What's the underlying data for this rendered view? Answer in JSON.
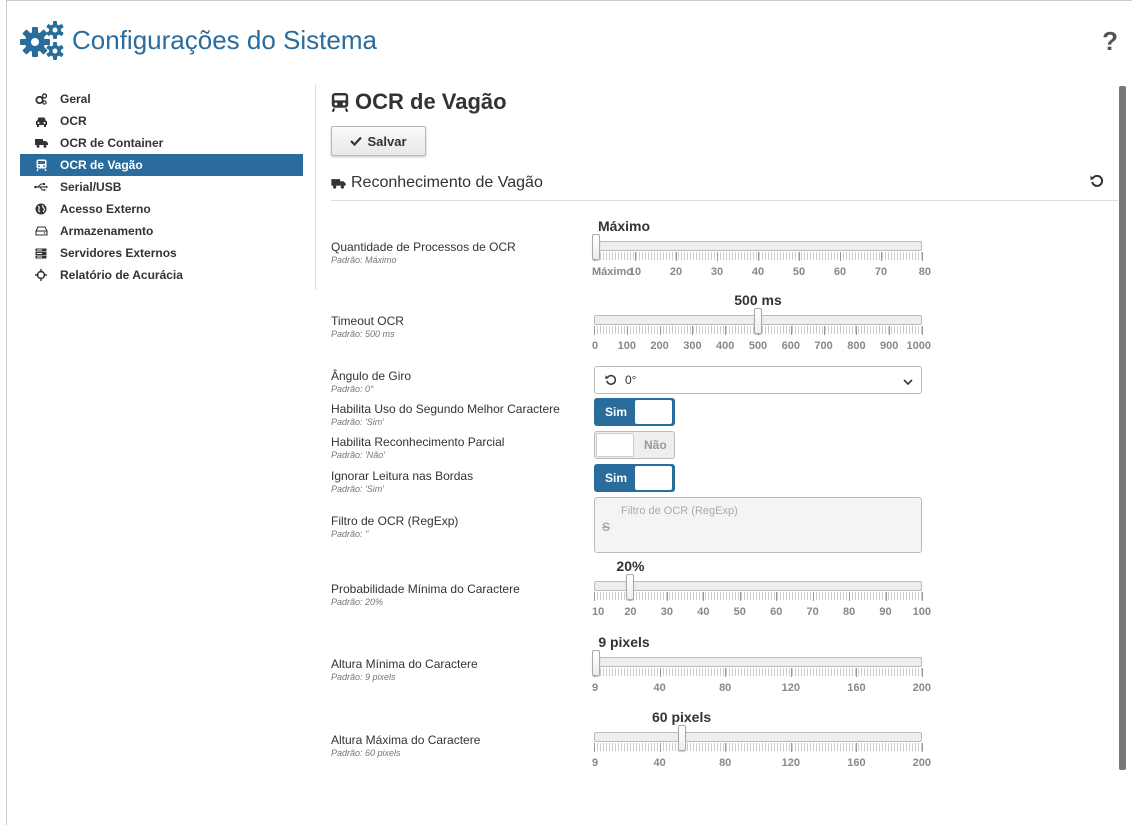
{
  "header": {
    "title": "Configurações do Sistema",
    "help": "?"
  },
  "sidebar": {
    "items": [
      {
        "label": "Geral",
        "icon": "gears-icon",
        "active": false
      },
      {
        "label": "OCR",
        "icon": "car-icon",
        "active": false
      },
      {
        "label": "OCR de Container",
        "icon": "truck-icon",
        "active": false
      },
      {
        "label": "OCR de Vagão",
        "icon": "train-icon",
        "active": true
      },
      {
        "label": "Serial/USB",
        "icon": "usb-icon",
        "active": false
      },
      {
        "label": "Acesso Externo",
        "icon": "globe-icon",
        "active": false
      },
      {
        "label": "Armazenamento",
        "icon": "hdd-icon",
        "active": false
      },
      {
        "label": "Servidores Externos",
        "icon": "server-icon",
        "active": false
      },
      {
        "label": "Relatório de Acurácia",
        "icon": "crosshair-icon",
        "active": false
      }
    ]
  },
  "main": {
    "title": "OCR de Vagão",
    "save_label": "Salvar",
    "section_title": "Reconhecimento de Vagão"
  },
  "fields": {
    "processos": {
      "label": "Quantidade de Processos de OCR",
      "default": "Padrão: Máximo",
      "value_label": "Máximo",
      "value_fraction": 0.0,
      "ticks": [
        "Máximo",
        "10",
        "20",
        "30",
        "40",
        "50",
        "60",
        "70",
        "80"
      ]
    },
    "timeout": {
      "label": "Timeout OCR",
      "default": "Padrão: 500 ms",
      "value_label": "500 ms",
      "value_fraction": 0.5,
      "ticks": [
        "0",
        "100",
        "200",
        "300",
        "400",
        "500",
        "600",
        "700",
        "800",
        "900",
        "1000"
      ]
    },
    "angulo": {
      "label": "Ângulo de Giro",
      "default": "Padrão: 0°",
      "selected": "0°"
    },
    "segundo": {
      "label": "Habilita Uso do Segundo Melhor Caractere",
      "default": "Padrão: 'Sim'",
      "state": "Sim"
    },
    "parcial": {
      "label": "Habilita Reconhecimento Parcial",
      "default": "Padrão: 'Não'",
      "state": "Não"
    },
    "bordas": {
      "label": "Ignorar Leitura nas Bordas",
      "default": "Padrão: 'Sim'",
      "state": "Sim"
    },
    "filtro": {
      "label": "Filtro de OCR (RegExp)",
      "default": "Padrão: ''",
      "placeholder": "Filtro de OCR (RegExp)",
      "icon_glyph": "S"
    },
    "probabilidade": {
      "label": "Probabilidade Mínima do Caractere",
      "default": "Padrão: 20%",
      "value_label": "20%",
      "value_fraction": 0.1111,
      "ticks": [
        "10",
        "20",
        "30",
        "40",
        "50",
        "60",
        "70",
        "80",
        "90",
        "100"
      ]
    },
    "altura_min": {
      "label": "Altura Mínima do Caractere",
      "default": "Padrão: 9 pixels",
      "value_label": "9 pixels",
      "value_fraction": 0.0,
      "ticks": [
        "9",
        "40",
        "80",
        "120",
        "160",
        "200"
      ]
    },
    "altura_max": {
      "label": "Altura Máxima do Caractere",
      "default": "Padrão: 60 pixels",
      "value_label": "60 pixels",
      "value_fraction": 0.267,
      "ticks": [
        "9",
        "40",
        "80",
        "120",
        "160",
        "200"
      ]
    }
  },
  "colors": {
    "accent": "#2a6c9c",
    "text": "#333333"
  }
}
